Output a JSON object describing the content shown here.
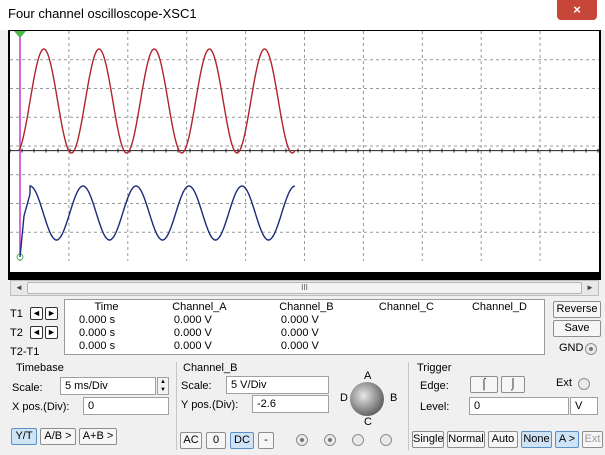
{
  "window": {
    "title": "Four channel oscilloscope-XSC1",
    "close_icon": "×"
  },
  "scrollbar": {
    "left": "◄",
    "right": "►",
    "grip": "III"
  },
  "cursors": {
    "t1": "T1",
    "t2": "T2",
    "t2t1": "T2-T1",
    "left_arrow": "◄",
    "right_arrow": "►"
  },
  "readout": {
    "headers": [
      "Time",
      "Channel_A",
      "Channel_B",
      "Channel_C",
      "Channel_D"
    ],
    "rows": [
      [
        "0.000 s",
        "0.000 V",
        "0.000 V",
        "",
        ""
      ],
      [
        "0.000 s",
        "0.000 V",
        "0.000 V",
        "",
        ""
      ],
      [
        "0.000 s",
        "0.000 V",
        "0.000 V",
        "",
        ""
      ]
    ]
  },
  "side_buttons": {
    "reverse": "Reverse",
    "save": "Save",
    "gnd": "GND"
  },
  "timebase": {
    "title": "Timebase",
    "scale_label": "Scale:",
    "scale_value": "5 ms/Div",
    "xpos_label": "X pos.(Div):",
    "xpos_value": "0",
    "modes": [
      "Y/T",
      "A/B >",
      "A+B >"
    ]
  },
  "channel": {
    "title": "Channel_B",
    "scale_label": "Scale:",
    "scale_value": "5  V/Div",
    "ypos_label": "Y pos.(Div):",
    "ypos_value": "-2.6",
    "coupling": [
      "AC",
      "0",
      "DC",
      "-"
    ],
    "knob_letters": {
      "a": "A",
      "b": "B",
      "c": "C",
      "d": "D"
    }
  },
  "trigger": {
    "title": "Trigger",
    "edge_label": "Edge:",
    "ext_label": "Ext",
    "rising_icon": "⌠",
    "falling_icon": "⌡",
    "level_label": "Level:",
    "level_value": "0",
    "level_unit": "V",
    "modes": [
      "Single",
      "Normal",
      "Auto",
      "None",
      "A >",
      "Ext"
    ]
  },
  "colors": {
    "channel_a": "#b0242b",
    "channel_b": "#1c2a78",
    "cursor": "#c93bd1"
  },
  "chart_data": {
    "type": "line",
    "series": [
      {
        "color": "#b0242b",
        "waveform": "sine",
        "cycles": 5
      },
      {
        "color": "#1c2a78",
        "waveform": "sine",
        "cycles": 5
      }
    ]
  }
}
